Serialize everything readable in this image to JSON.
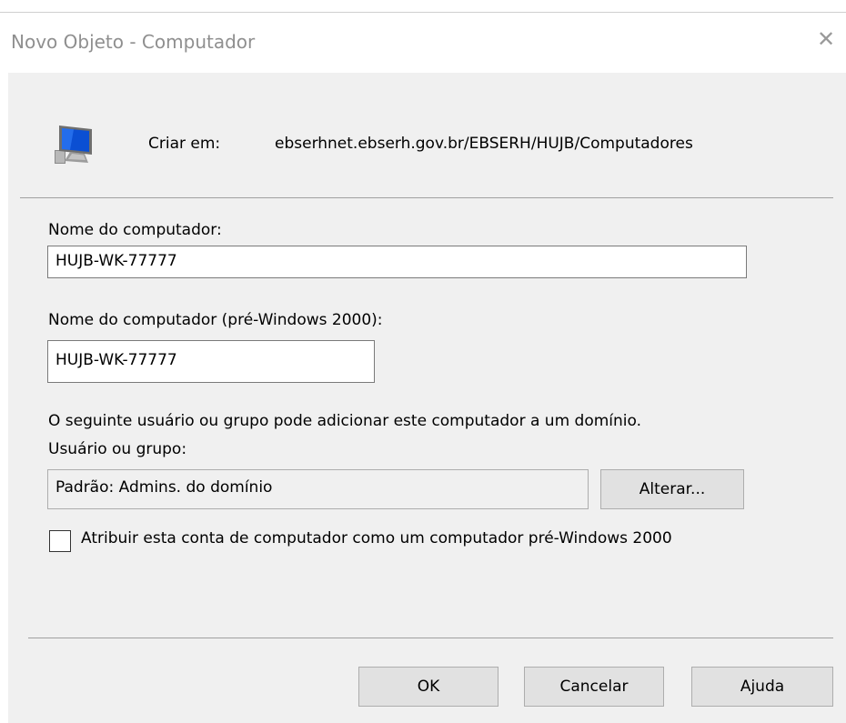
{
  "window": {
    "title": "Novo Objeto - Computador",
    "close_glyph": "✕"
  },
  "header": {
    "icon": "computer-icon",
    "create_in_label": "Criar em:",
    "create_in_path": "ebserhnet.ebserh.gov.br/EBSERH/HUJB/Computadores"
  },
  "form": {
    "computer_name_label": "Nome do computador:",
    "computer_name_value": "HUJB-WK-77777",
    "pre2000_name_label": "Nome do computador (pré-Windows 2000):",
    "pre2000_name_value": "HUJB-WK-77777",
    "info_text": "O seguinte usuário ou grupo pode adicionar este computador a um domínio.",
    "user_group_label": "Usuário ou grupo:",
    "user_group_value": "Padrão: Admins. do domínio",
    "change_button": "Alterar...",
    "checkbox_label": "Atribuir esta conta de computador como um computador pré-Windows 2000",
    "checkbox_checked": false
  },
  "buttons": {
    "ok": "OK",
    "cancel": "Cancelar",
    "help": "Ajuda"
  }
}
